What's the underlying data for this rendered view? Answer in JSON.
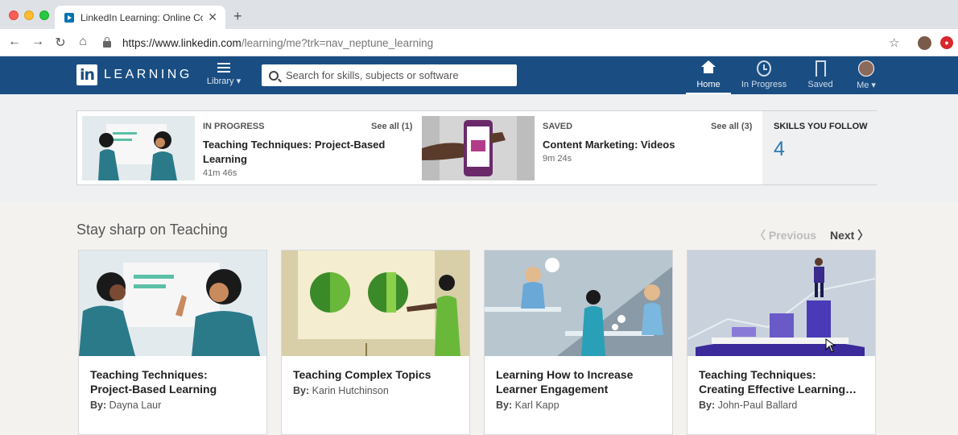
{
  "browser": {
    "tab_title": "LinkedIn Learning: Online Cou",
    "new_tab": "+",
    "tab_close": "✕",
    "url_host": "https://www.linkedin.com",
    "url_path": "/learning/me?trk=nav_neptune_learning"
  },
  "header": {
    "logo_letters": "in",
    "logo_word": "LEARNING",
    "library_label": "Library ▾",
    "search_placeholder": "Search for skills, subjects or software",
    "nav": {
      "home": "Home",
      "in_progress": "In Progress",
      "saved": "Saved",
      "me": "Me ▾"
    }
  },
  "summary": {
    "in_progress": {
      "label": "IN PROGRESS",
      "see_all": "See all (1)",
      "title_line1": "Teaching Techniques: Project-Based",
      "title_line2": "Learning",
      "duration": "41m 46s"
    },
    "saved": {
      "label": "SAVED",
      "see_all": "See all (3)",
      "title": "Content Marketing: Videos",
      "duration": "9m 24s"
    },
    "skills": {
      "label": "SKILLS YOU FOLLOW",
      "count": "4"
    }
  },
  "section": {
    "title": "Stay sharp on Teaching",
    "previous": "〈  Previous",
    "next": "Next  〉"
  },
  "courses": [
    {
      "title_line1": "Teaching Techniques:",
      "title_line2": "Project-Based Learning",
      "by": "By:",
      "author": "Dayna Laur"
    },
    {
      "title_line1": "Teaching Complex Topics",
      "title_line2": "",
      "by": "By:",
      "author": "Karin Hutchinson"
    },
    {
      "title_line1": "Learning How to Increase",
      "title_line2": "Learner Engagement",
      "by": "By:",
      "author": "Karl Kapp"
    },
    {
      "title_line1": "Teaching Techniques:",
      "title_line2": "Creating Effective Learning…",
      "by": "By:",
      "author": "John-Paul Ballard"
    }
  ],
  "colors": {
    "brand_blue": "#1a4e82",
    "skills_accent": "#2d7ab3"
  }
}
